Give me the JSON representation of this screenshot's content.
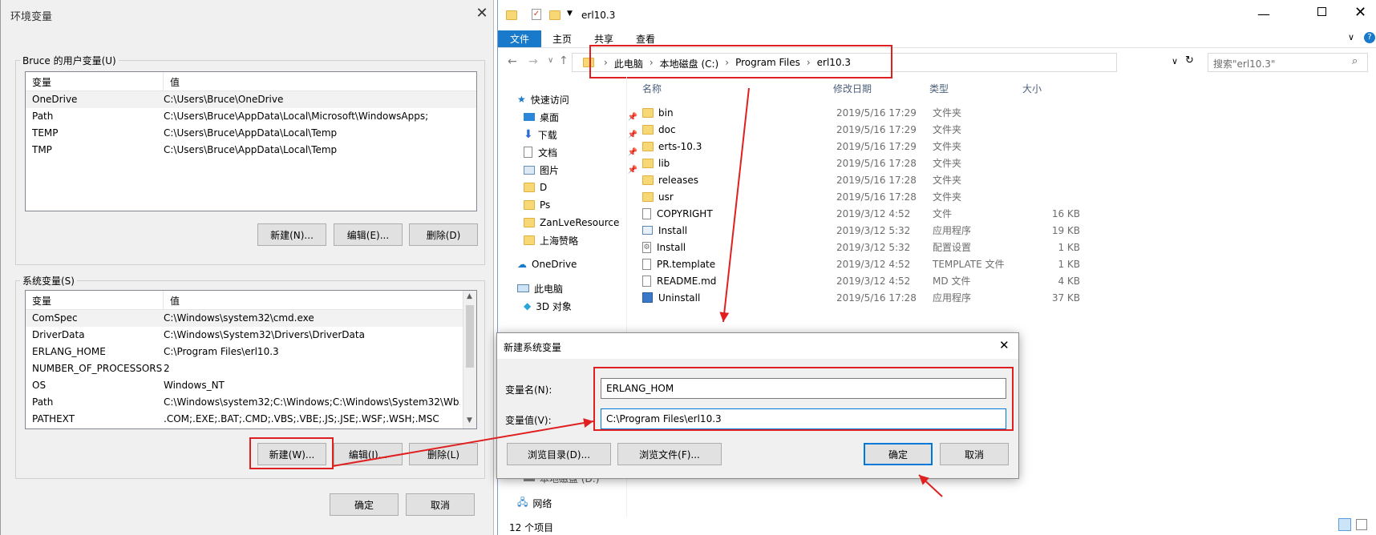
{
  "env_dialog": {
    "title": "环境变量",
    "close": "✕",
    "user_group": {
      "label": "Bruce 的用户变量(U)",
      "col_var": "变量",
      "col_val": "值",
      "rows": [
        {
          "name": "OneDrive",
          "value": "C:\\Users\\Bruce\\OneDrive"
        },
        {
          "name": "Path",
          "value": "C:\\Users\\Bruce\\AppData\\Local\\Microsoft\\WindowsApps;"
        },
        {
          "name": "TEMP",
          "value": "C:\\Users\\Bruce\\AppData\\Local\\Temp"
        },
        {
          "name": "TMP",
          "value": "C:\\Users\\Bruce\\AppData\\Local\\Temp"
        }
      ],
      "new_btn": "新建(N)...",
      "edit_btn": "编辑(E)...",
      "delete_btn": "删除(D)"
    },
    "sys_group": {
      "label": "系统变量(S)",
      "col_var": "变量",
      "col_val": "值",
      "rows": [
        {
          "name": "ComSpec",
          "value": "C:\\Windows\\system32\\cmd.exe"
        },
        {
          "name": "DriverData",
          "value": "C:\\Windows\\System32\\Drivers\\DriverData"
        },
        {
          "name": "ERLANG_HOME",
          "value": "C:\\Program Files\\erl10.3"
        },
        {
          "name": "NUMBER_OF_PROCESSORS",
          "value": "2"
        },
        {
          "name": "OS",
          "value": "Windows_NT"
        },
        {
          "name": "Path",
          "value": "C:\\Windows\\system32;C:\\Windows;C:\\Windows\\System32\\Wb..."
        },
        {
          "name": "PATHEXT",
          "value": ".COM;.EXE;.BAT;.CMD;.VBS;.VBE;.JS;.JSE;.WSF;.WSH;.MSC"
        }
      ],
      "new_btn": "新建(W)...",
      "edit_btn": "编辑(I)...",
      "delete_btn": "删除(L)"
    },
    "ok_btn": "确定",
    "cancel_btn": "取消"
  },
  "explorer": {
    "title": "erl10.3",
    "tabs": [
      "文件",
      "主页",
      "共享",
      "查看"
    ],
    "breadcrumb": [
      "此电脑",
      "本地磁盘 (C:)",
      "Program Files",
      "erl10.3"
    ],
    "search_placeholder": "搜索\"erl10.3\"",
    "nav": [
      {
        "label": "快速访问",
        "icon": "star-icon"
      },
      {
        "label": "桌面",
        "icon": "desktop-icon"
      },
      {
        "label": "下载",
        "icon": "download-icon"
      },
      {
        "label": "文档",
        "icon": "documents-icon"
      },
      {
        "label": "图片",
        "icon": "pictures-icon"
      },
      {
        "label": "D",
        "icon": "folder-icon"
      },
      {
        "label": "Ps",
        "icon": "folder-icon"
      },
      {
        "label": "ZanLveResource",
        "icon": "folder-icon"
      },
      {
        "label": "上海赞略",
        "icon": "folder-icon"
      },
      {
        "label": "OneDrive",
        "icon": "cloud-icon"
      },
      {
        "label": "此电脑",
        "icon": "computer-icon"
      },
      {
        "label": "3D 对象",
        "icon": "cube-icon"
      },
      {
        "label": "本地磁盘 (D:)",
        "icon": "drive-icon"
      },
      {
        "label": "网络",
        "icon": "network-icon"
      }
    ],
    "columns": {
      "name": "名称",
      "date": "修改日期",
      "type": "类型",
      "size": "大小"
    },
    "files": [
      {
        "name": "bin",
        "date": "2019/5/16 17:29",
        "type": "文件夹",
        "size": "",
        "icon": "folder-icon"
      },
      {
        "name": "doc",
        "date": "2019/5/16 17:29",
        "type": "文件夹",
        "size": "",
        "icon": "folder-icon"
      },
      {
        "name": "erts-10.3",
        "date": "2019/5/16 17:29",
        "type": "文件夹",
        "size": "",
        "icon": "folder-icon"
      },
      {
        "name": "lib",
        "date": "2019/5/16 17:28",
        "type": "文件夹",
        "size": "",
        "icon": "folder-icon"
      },
      {
        "name": "releases",
        "date": "2019/5/16 17:28",
        "type": "文件夹",
        "size": "",
        "icon": "folder-icon"
      },
      {
        "name": "usr",
        "date": "2019/5/16 17:28",
        "type": "文件夹",
        "size": "",
        "icon": "folder-icon"
      },
      {
        "name": "COPYRIGHT",
        "date": "2019/3/12 4:52",
        "type": "文件",
        "size": "16 KB",
        "icon": "file-icon"
      },
      {
        "name": "Install",
        "date": "2019/3/12 5:32",
        "type": "应用程序",
        "size": "19 KB",
        "icon": "app-icon"
      },
      {
        "name": "Install",
        "date": "2019/3/12 5:32",
        "type": "配置设置",
        "size": "1 KB",
        "icon": "settings-file-icon"
      },
      {
        "name": "PR.template",
        "date": "2019/3/12 4:52",
        "type": "TEMPLATE 文件",
        "size": "1 KB",
        "icon": "file-icon"
      },
      {
        "name": "README.md",
        "date": "2019/3/12 4:52",
        "type": "MD 文件",
        "size": "4 KB",
        "icon": "file-icon"
      },
      {
        "name": "Uninstall",
        "date": "2019/5/16 17:28",
        "type": "应用程序",
        "size": "37 KB",
        "icon": "uninstall-icon"
      }
    ],
    "status": "12 个项目"
  },
  "new_var_dialog": {
    "title": "新建系统变量",
    "name_label": "变量名(N):",
    "value_label": "变量值(V):",
    "name_value": "ERLANG_HOM",
    "value_value": "C:\\Program Files\\erl10.3",
    "browse_dir": "浏览目录(D)...",
    "browse_file": "浏览文件(F)...",
    "ok": "确定",
    "cancel": "取消"
  },
  "colors": {
    "accent": "#0078d7",
    "highlight": "#e02020",
    "file_tab": "#1979ca"
  }
}
